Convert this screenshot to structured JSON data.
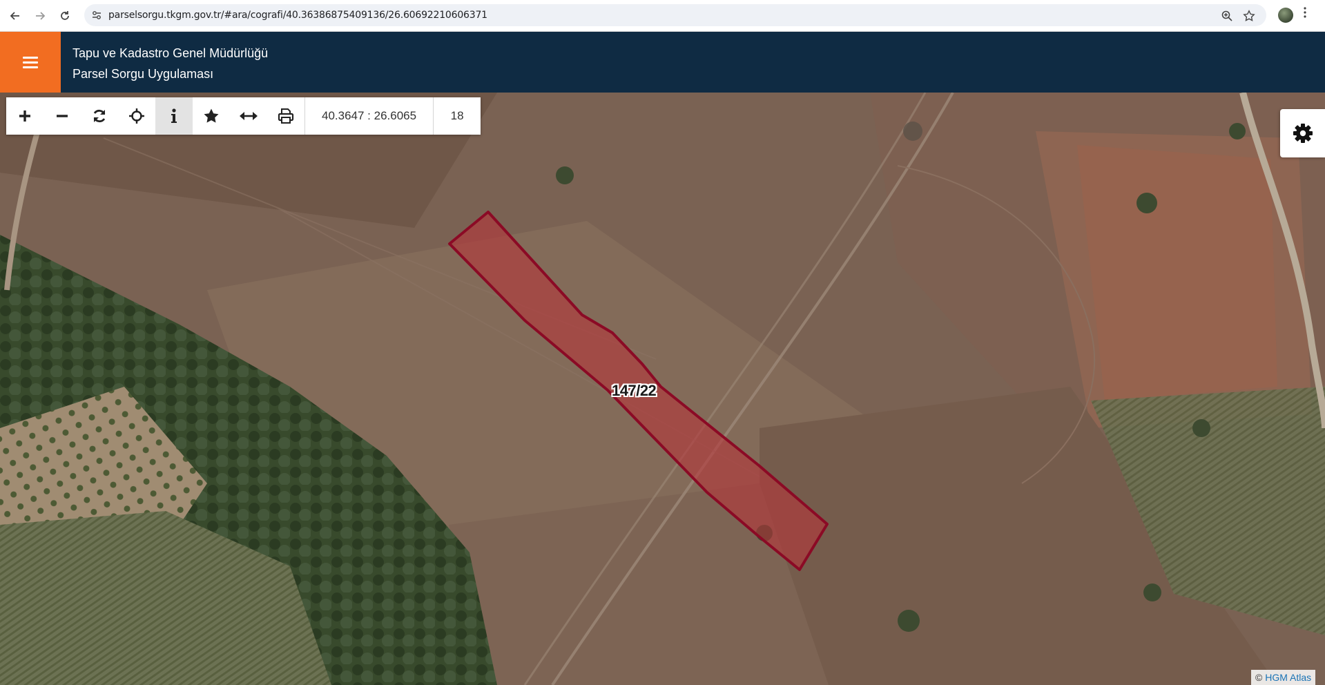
{
  "browser": {
    "url": "parselsorgu.tkgm.gov.tr/#ara/cografi/40.36386875409136/26.60692210606371"
  },
  "header": {
    "title_line1": "Tapu ve Kadastro Genel Müdürlüğü",
    "title_line2": "Parsel Sorgu Uygulaması",
    "accent_color": "#f26d21",
    "bar_color": "#0f2b43"
  },
  "toolbar": {
    "tools": [
      {
        "name": "zoom-in",
        "icon": "plus-icon"
      },
      {
        "name": "zoom-out",
        "icon": "minus-icon"
      },
      {
        "name": "refresh",
        "icon": "refresh-icon"
      },
      {
        "name": "locate",
        "icon": "crosshair-icon"
      },
      {
        "name": "info",
        "icon": "info-icon",
        "active": true
      },
      {
        "name": "favorites",
        "icon": "star-icon"
      },
      {
        "name": "measure",
        "icon": "arrows-horizontal-icon"
      },
      {
        "name": "print",
        "icon": "printer-icon"
      }
    ],
    "coordinates": "40.3647 : 26.6065",
    "zoom_level": "18"
  },
  "map": {
    "parcel_label": "147/22",
    "parcel_stroke": "#8b0a25",
    "parcel_fill": "#b5363b",
    "attribution_prefix": "©",
    "attribution_link": "HGM Atlas"
  }
}
